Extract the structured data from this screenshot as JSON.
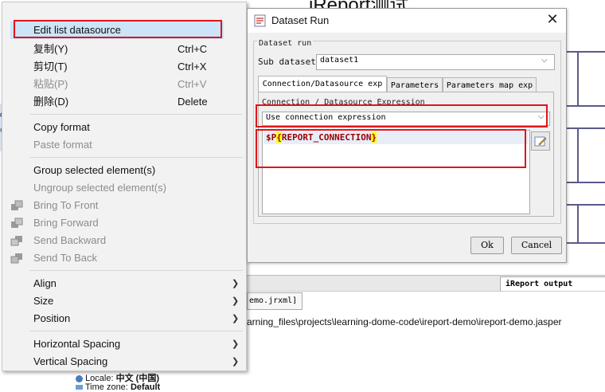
{
  "background": {
    "title": "iReport测试",
    "left_fragment": "on",
    "left_fragment2": "e",
    "output_tab": "iReport output",
    "file_tab": "emo.jrxml]",
    "path_text": "arning_files\\projects\\learning-dome-code\\ireport-demo\\ireport-demo.jasper",
    "locale_label": "Locale:",
    "locale_value": "中文 (中国)",
    "timezone_label": "Time zone:",
    "timezone_value": "Default"
  },
  "context_menu": {
    "items": [
      {
        "label": "Edit list datasource",
        "shortcut": "",
        "disabled": false,
        "highlighted": true
      },
      {
        "label": "复制(Y)",
        "shortcut": "Ctrl+C",
        "disabled": false
      },
      {
        "label": "剪切(T)",
        "shortcut": "Ctrl+X",
        "disabled": false
      },
      {
        "label": "粘贴(P)",
        "shortcut": "Ctrl+V",
        "disabled": true
      },
      {
        "label": "删除(D)",
        "shortcut": "Delete",
        "disabled": false
      },
      {
        "label": "Copy format",
        "shortcut": "",
        "disabled": false
      },
      {
        "label": "Paste format",
        "shortcut": "",
        "disabled": true
      },
      {
        "label": "Group selected element(s)",
        "shortcut": "",
        "disabled": false
      },
      {
        "label": "Ungroup selected element(s)",
        "shortcut": "",
        "disabled": true
      },
      {
        "label": "Bring To Front",
        "shortcut": "",
        "disabled": true,
        "icon": "bring-to-front-icon"
      },
      {
        "label": "Bring Forward",
        "shortcut": "",
        "disabled": true,
        "icon": "bring-forward-icon"
      },
      {
        "label": "Send Backward",
        "shortcut": "",
        "disabled": true,
        "icon": "send-backward-icon"
      },
      {
        "label": "Send To Back",
        "shortcut": "",
        "disabled": true,
        "icon": "send-to-back-icon"
      },
      {
        "label": "Align",
        "submenu": true
      },
      {
        "label": "Size",
        "submenu": true
      },
      {
        "label": "Position",
        "submenu": true
      },
      {
        "label": "Horizontal Spacing",
        "submenu": true
      },
      {
        "label": "Vertical Spacing",
        "submenu": true
      }
    ]
  },
  "dialog": {
    "title": "Dataset Run",
    "group_label": "Dataset run",
    "sub_dataset_label": "Sub dataset",
    "sub_dataset_value": "dataset1",
    "tabs": [
      "Connection/Datasource exp",
      "Parameters",
      "Parameters map exp"
    ],
    "conn_label": "Connection / Datasource Expression",
    "conn_select_value": "Use connection expression",
    "expr_prefix": "$P",
    "expr_open": "{",
    "expr_param": "REPORT_CONNECTION",
    "expr_close": "}",
    "ok_label": "Ok",
    "cancel_label": "Cancel"
  },
  "colors": {
    "menu_highlight": "#cce4f7",
    "highlight_red": "#e0141a",
    "expr_color": "#9a0000",
    "brace_highlight": "#ffff00"
  }
}
